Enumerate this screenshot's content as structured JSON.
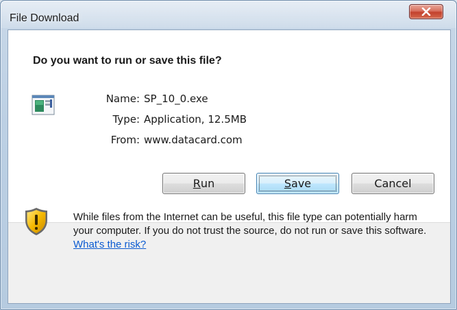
{
  "window": {
    "title": "File Download",
    "close_glyph": "x"
  },
  "dialog": {
    "question": "Do you want to run or save this file?",
    "file_icon": "application-file-icon",
    "details": {
      "name_label": "Name:",
      "name_value": "SP_10_0.exe",
      "type_label": "Type:",
      "type_value": "Application, 12.5MB",
      "from_label": "From:",
      "from_value": "www.datacard.com"
    },
    "buttons": {
      "run_mnemonic": "R",
      "run_rest": "un",
      "save_mnemonic": "S",
      "save_rest": "ave",
      "cancel": "Cancel",
      "default": "save"
    }
  },
  "warning": {
    "icon": "security-shield-warning-icon",
    "text": "While files from the Internet can be useful, this file type can potentially harm your computer. If you do not trust the source, do not run or save this software.",
    "link_text": "What's the risk?"
  },
  "colors": {
    "link": "#0a5ad1",
    "close_button": "#c3412d",
    "default_button_border": "#3c7fb1",
    "lower_panel": "#f0f0f0"
  }
}
